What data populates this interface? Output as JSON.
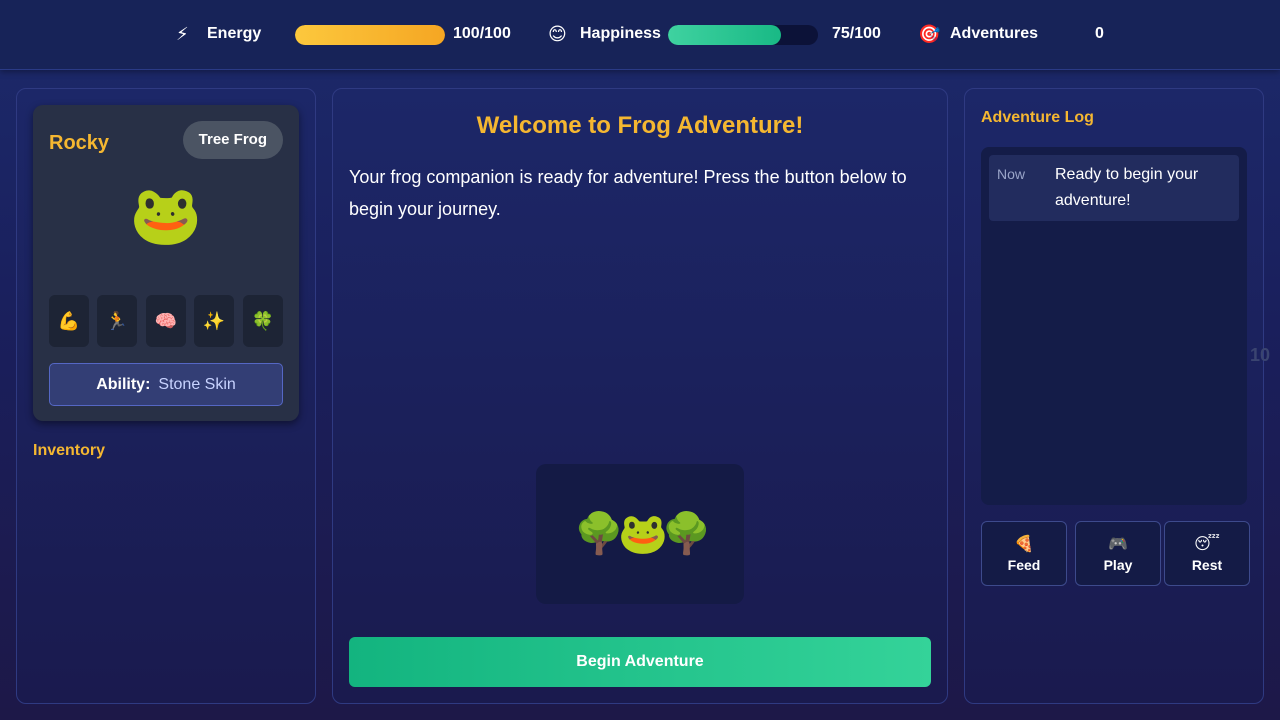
{
  "stats": {
    "energy": {
      "icon": "⚡",
      "label": "Energy",
      "value": 100,
      "max": 100,
      "text": "100/100",
      "color": "#f5a623"
    },
    "happiness": {
      "icon": "😊",
      "label": "Happiness",
      "value": 75,
      "max": 100,
      "text": "75/100",
      "color": "#19b985"
    },
    "adventures": {
      "icon": "🎯",
      "label": "Adventures",
      "count": "0"
    }
  },
  "frog": {
    "name": "Rocky",
    "type": "Tree Frog",
    "avatar": "🐸",
    "traits": [
      {
        "icon": "💪",
        "name": "strength-icon"
      },
      {
        "icon": "🏃",
        "name": "speed-icon"
      },
      {
        "icon": "🧠",
        "name": "intelligence-icon"
      },
      {
        "icon": "✨",
        "name": "magic-icon"
      },
      {
        "icon": "🍀",
        "name": "luck-icon"
      }
    ],
    "ability_label": "Ability:",
    "ability_value": "Stone Skin"
  },
  "inventory": {
    "title": "Inventory"
  },
  "main": {
    "title": "Welcome to Frog Adventure!",
    "story": "Your frog companion is ready for adventure! Press the button below to begin your journey.",
    "scene": "🌳🐸🌳",
    "begin_label": "Begin Adventure"
  },
  "log": {
    "title": "Adventure Log",
    "entries": [
      {
        "time": "Now",
        "message": "Ready to begin your adventure!"
      }
    ]
  },
  "actions": [
    {
      "icon": "🍕",
      "label": "Feed"
    },
    {
      "icon": "🎮",
      "label": "Play"
    },
    {
      "icon": "😴",
      "label": "Rest"
    }
  ],
  "side_number": "10",
  "colors": {
    "accent": "#f5b731",
    "button": "#13b47f"
  }
}
